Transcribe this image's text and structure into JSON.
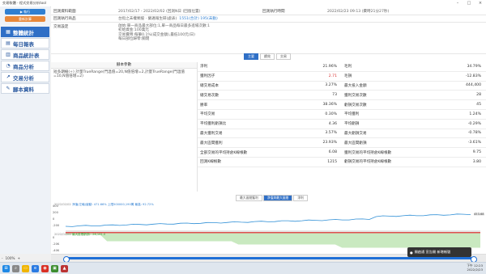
{
  "window": {
    "title": "交易軟體 - 程式交易分析tool"
  },
  "toolbar": {
    "run_label": "▶ 執行",
    "reset_label": "重新計算"
  },
  "sidebar": {
    "items": [
      {
        "label": "整體統計",
        "icon": "bar-chart-icon",
        "active": true
      },
      {
        "label": "每日報表",
        "icon": "calendar-icon",
        "active": false
      },
      {
        "label": "商品統計表",
        "icon": "table-icon",
        "active": false
      },
      {
        "label": "商品分析",
        "icon": "pie-icon",
        "active": false
      },
      {
        "label": "交易分析",
        "icon": "trend-icon",
        "active": false
      },
      {
        "label": "腳本資料",
        "icon": "script-icon",
        "active": false
      }
    ]
  },
  "zoom": {
    "value": "100%",
    "minus": "-",
    "plus": "+"
  },
  "info": {
    "range_label": "回測資料範圍",
    "range_value": "2017/02/17 - 2022/02/02 (回測N日 (回復位置)",
    "exec_label": "回測執行時間",
    "exec_value": "2022/02/23 09:13 (費時21分27秒)",
    "product_label": "回測執行商品",
    "product_value": "台指之未權類股 · 蘭邁報生研(處表)",
    "product_extra": "1551(合計) 195(未動)",
    "orig_label": "交易設定",
    "orig_lines": [
      "啟始:單一商品最大部位:1,單一商品每日最多進場次數:1",
      "初始資金:100萬元",
      "交易費用:每筆0.1%(成交金額),最低100元(日)",
      "每日部位歸零:關閉"
    ]
  },
  "tabs": [
    {
      "label": "主要",
      "on": true
    },
    {
      "label": "績效",
      "on": false
    },
    {
      "label": "交易",
      "on": false
    }
  ],
  "params": {
    "header": "腳本參數",
    "text": "短多期線(+) 計量TrueRange(門溫值=20,N值倍增=2,計量TrueRange(門溫值=10,N值倍增=2)"
  },
  "stats": [
    {
      "l1": "淨利",
      "v1": "21.96%",
      "l2": "毛利",
      "v2": "34.79%",
      "r1": false,
      "r2": false
    },
    {
      "l1": "獲利因子",
      "v1": "2.71",
      "l2": "毛損",
      "v2": "-12.83%",
      "r1": true,
      "r2": false
    },
    {
      "l1": "總交易成本",
      "v1": "3.27%",
      "l2": "最大投入金額",
      "v2": "444,400",
      "r1": false,
      "r2": false
    },
    {
      "l1": "總交易次數",
      "v1": "73",
      "l2": "獲利交易次數",
      "v2": "28",
      "r1": false,
      "r2": false
    },
    {
      "l1": "勝率",
      "v1": "38.36%",
      "l2": "虧損交易次數",
      "v2": "45",
      "r1": false,
      "r2": false
    },
    {
      "l1": "平均交易",
      "v1": "0.30%",
      "l2": "平均獲利",
      "v2": "1.24%",
      "r1": false,
      "r2": false
    },
    {
      "l1": "平均獲利虧損比",
      "v1": "4.36",
      "l2": "平均虧損",
      "v2": "-0.29%",
      "r1": false,
      "r2": false
    },
    {
      "l1": "最大獲利交易",
      "v1": "3.57%",
      "l2": "最大虧損交易",
      "v2": "-0.78%",
      "r1": false,
      "r2": false
    },
    {
      "l1": "最大區間獲利",
      "v1": "23.93%",
      "l2": "最大區間虧損",
      "v2": "-3.61%",
      "r1": false,
      "r2": false
    },
    {
      "l1": "全部交易的平均持倉K線根數",
      "v1": "6.08",
      "l2": "獲利交易的平均持倉K線根數",
      "v2": "9.75",
      "r1": false,
      "r2": false
    },
    {
      "l1": "回測K線根數",
      "v1": "1215",
      "l2": "虧損交易的平均持倉K線根數",
      "v2": "3.80",
      "r1": false,
      "r2": false
    }
  ],
  "chart_tabs": [
    {
      "label": "最大區間獲利",
      "on": false
    },
    {
      "label": "淨值與最大區間",
      "on": true
    },
    {
      "label": "淨利",
      "on": false
    }
  ],
  "chart": {
    "date_top": "2022/02/02",
    "legend_top": "淨值(左軸)變動: 471.66% 上限500000,190萬 最高: 92.72%",
    "date_bottom": "2022/02/02",
    "legend_bottom": "最大區間虧損: -26,161.0",
    "y_top_ticks": [
      "400",
      "200",
      "0",
      "-200"
    ],
    "y_bot_ticks": [
      "0",
      "-20K",
      "-40K"
    ],
    "last_value": "453.68",
    "x_ticks": [
      "2017/02/17",
      "07",
      "2018/01",
      "07",
      "2019/01",
      "07",
      "2020/01",
      "07",
      "2021/01",
      "07"
    ],
    "line_color": "#2f8fd6",
    "dd_color": "#c9e9c0"
  },
  "tray": {
    "time": "下午 12:23",
    "date": "2022/2/23"
  },
  "notification": "開啟通 宣告開 新增帳號"
}
